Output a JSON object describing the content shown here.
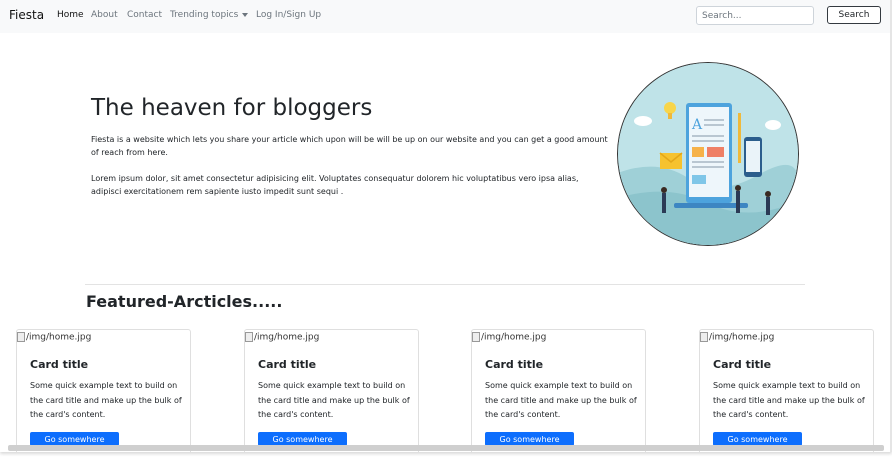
{
  "navbar": {
    "brand": "Fiesta",
    "links": [
      {
        "label": "Home"
      },
      {
        "label": "About"
      },
      {
        "label": "Contact"
      },
      {
        "label": "Trending topics"
      },
      {
        "label": "Log In/Sign Up"
      }
    ],
    "search_placeholder": "Search...",
    "search_button": "Search"
  },
  "hero": {
    "title": "The heaven for bloggers",
    "paragraph1": "Fiesta is a website which lets you share your article which upon will be will be up on our website and you can get a good amount of reach from here.",
    "paragraph2": "Lorem ipsum dolor, sit amet consectetur adipisicing elit. Voluptates consequatur dolorem hic voluptatibus vero ipsa alias, adipisci exercitationem rem sapiente iusto impedit sunt sequi ."
  },
  "featured": {
    "title": "Featured-Arcticles.....",
    "cards": [
      {
        "img_alt": "/img/home.jpg",
        "title": "Card title",
        "text": "Some quick example text to build on the card title and make up the bulk of the card's content.",
        "button": "Go somewhere"
      },
      {
        "img_alt": "/img/home.jpg",
        "title": "Card title",
        "text": "Some quick example text to build on the card title and make up the bulk of the card's content.",
        "button": "Go somewhere"
      },
      {
        "img_alt": "/img/home.jpg",
        "title": "Card title",
        "text": "Some quick example text to build on the card title and make up the bulk of the card's content.",
        "button": "Go somewhere"
      },
      {
        "img_alt": "/img/home.jpg",
        "title": "Card title",
        "text": "Some quick example text to build on the card title and make up the bulk of the card's content.",
        "button": "Go somewhere"
      }
    ]
  },
  "colors": {
    "primary": "#0d6efd",
    "navbar_bg": "#f8f9fa",
    "muted_link": "#6c757d"
  }
}
